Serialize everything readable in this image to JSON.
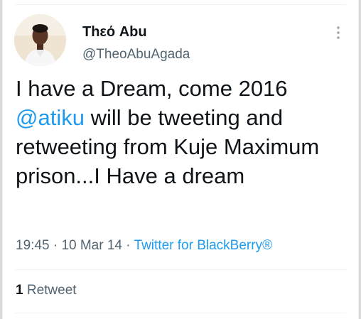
{
  "tweet": {
    "author_name": "Thεό Abu",
    "author_handle": "@TheoAbuAgada",
    "text_before_mention": "I have a Dream, come 2016 ",
    "mention": "@atiku",
    "text_after_mention": " will be tweeting and retweeting from Kuje Maximum prison...I Have a dream",
    "time": "19:45",
    "separator": " · ",
    "date": "10 Mar 14",
    "source": "Twitter for BlackBerry®",
    "retweet_count": "1",
    "retweet_label": "Retweet"
  },
  "icons": {
    "more": "more-vertical-icon",
    "avatar": "profile-photo"
  },
  "colors": {
    "link": "#1d9bf0",
    "text": "#0f1419",
    "secondary": "#536471"
  }
}
